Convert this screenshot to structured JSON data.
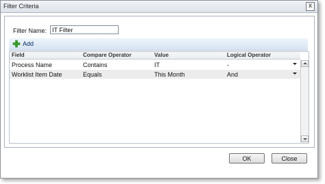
{
  "window": {
    "title": "Filter Criteria",
    "close_glyph": "x"
  },
  "form": {
    "filter_name_label": "Filter Name:",
    "filter_name_value": "IT Filter"
  },
  "toolbar": {
    "add_label": "Add",
    "add_icon": "green-plus-icon"
  },
  "grid": {
    "columns": [
      "Field",
      "Compare Operator",
      "Value",
      "Logical Operator"
    ],
    "rows": [
      {
        "field": "Process Name",
        "operator": "Contains",
        "value": "IT",
        "logical": "-"
      },
      {
        "field": "Worklist Item Date",
        "operator": "Equals",
        "value": "This Month",
        "logical": "And"
      }
    ]
  },
  "buttons": {
    "ok": "OK",
    "close": "Close"
  },
  "colors": {
    "add_plus": "#3aa22b",
    "toolbar_top": "#eef4fb",
    "toolbar_bottom": "#d6e4f3",
    "alt_row": "#ececec"
  }
}
